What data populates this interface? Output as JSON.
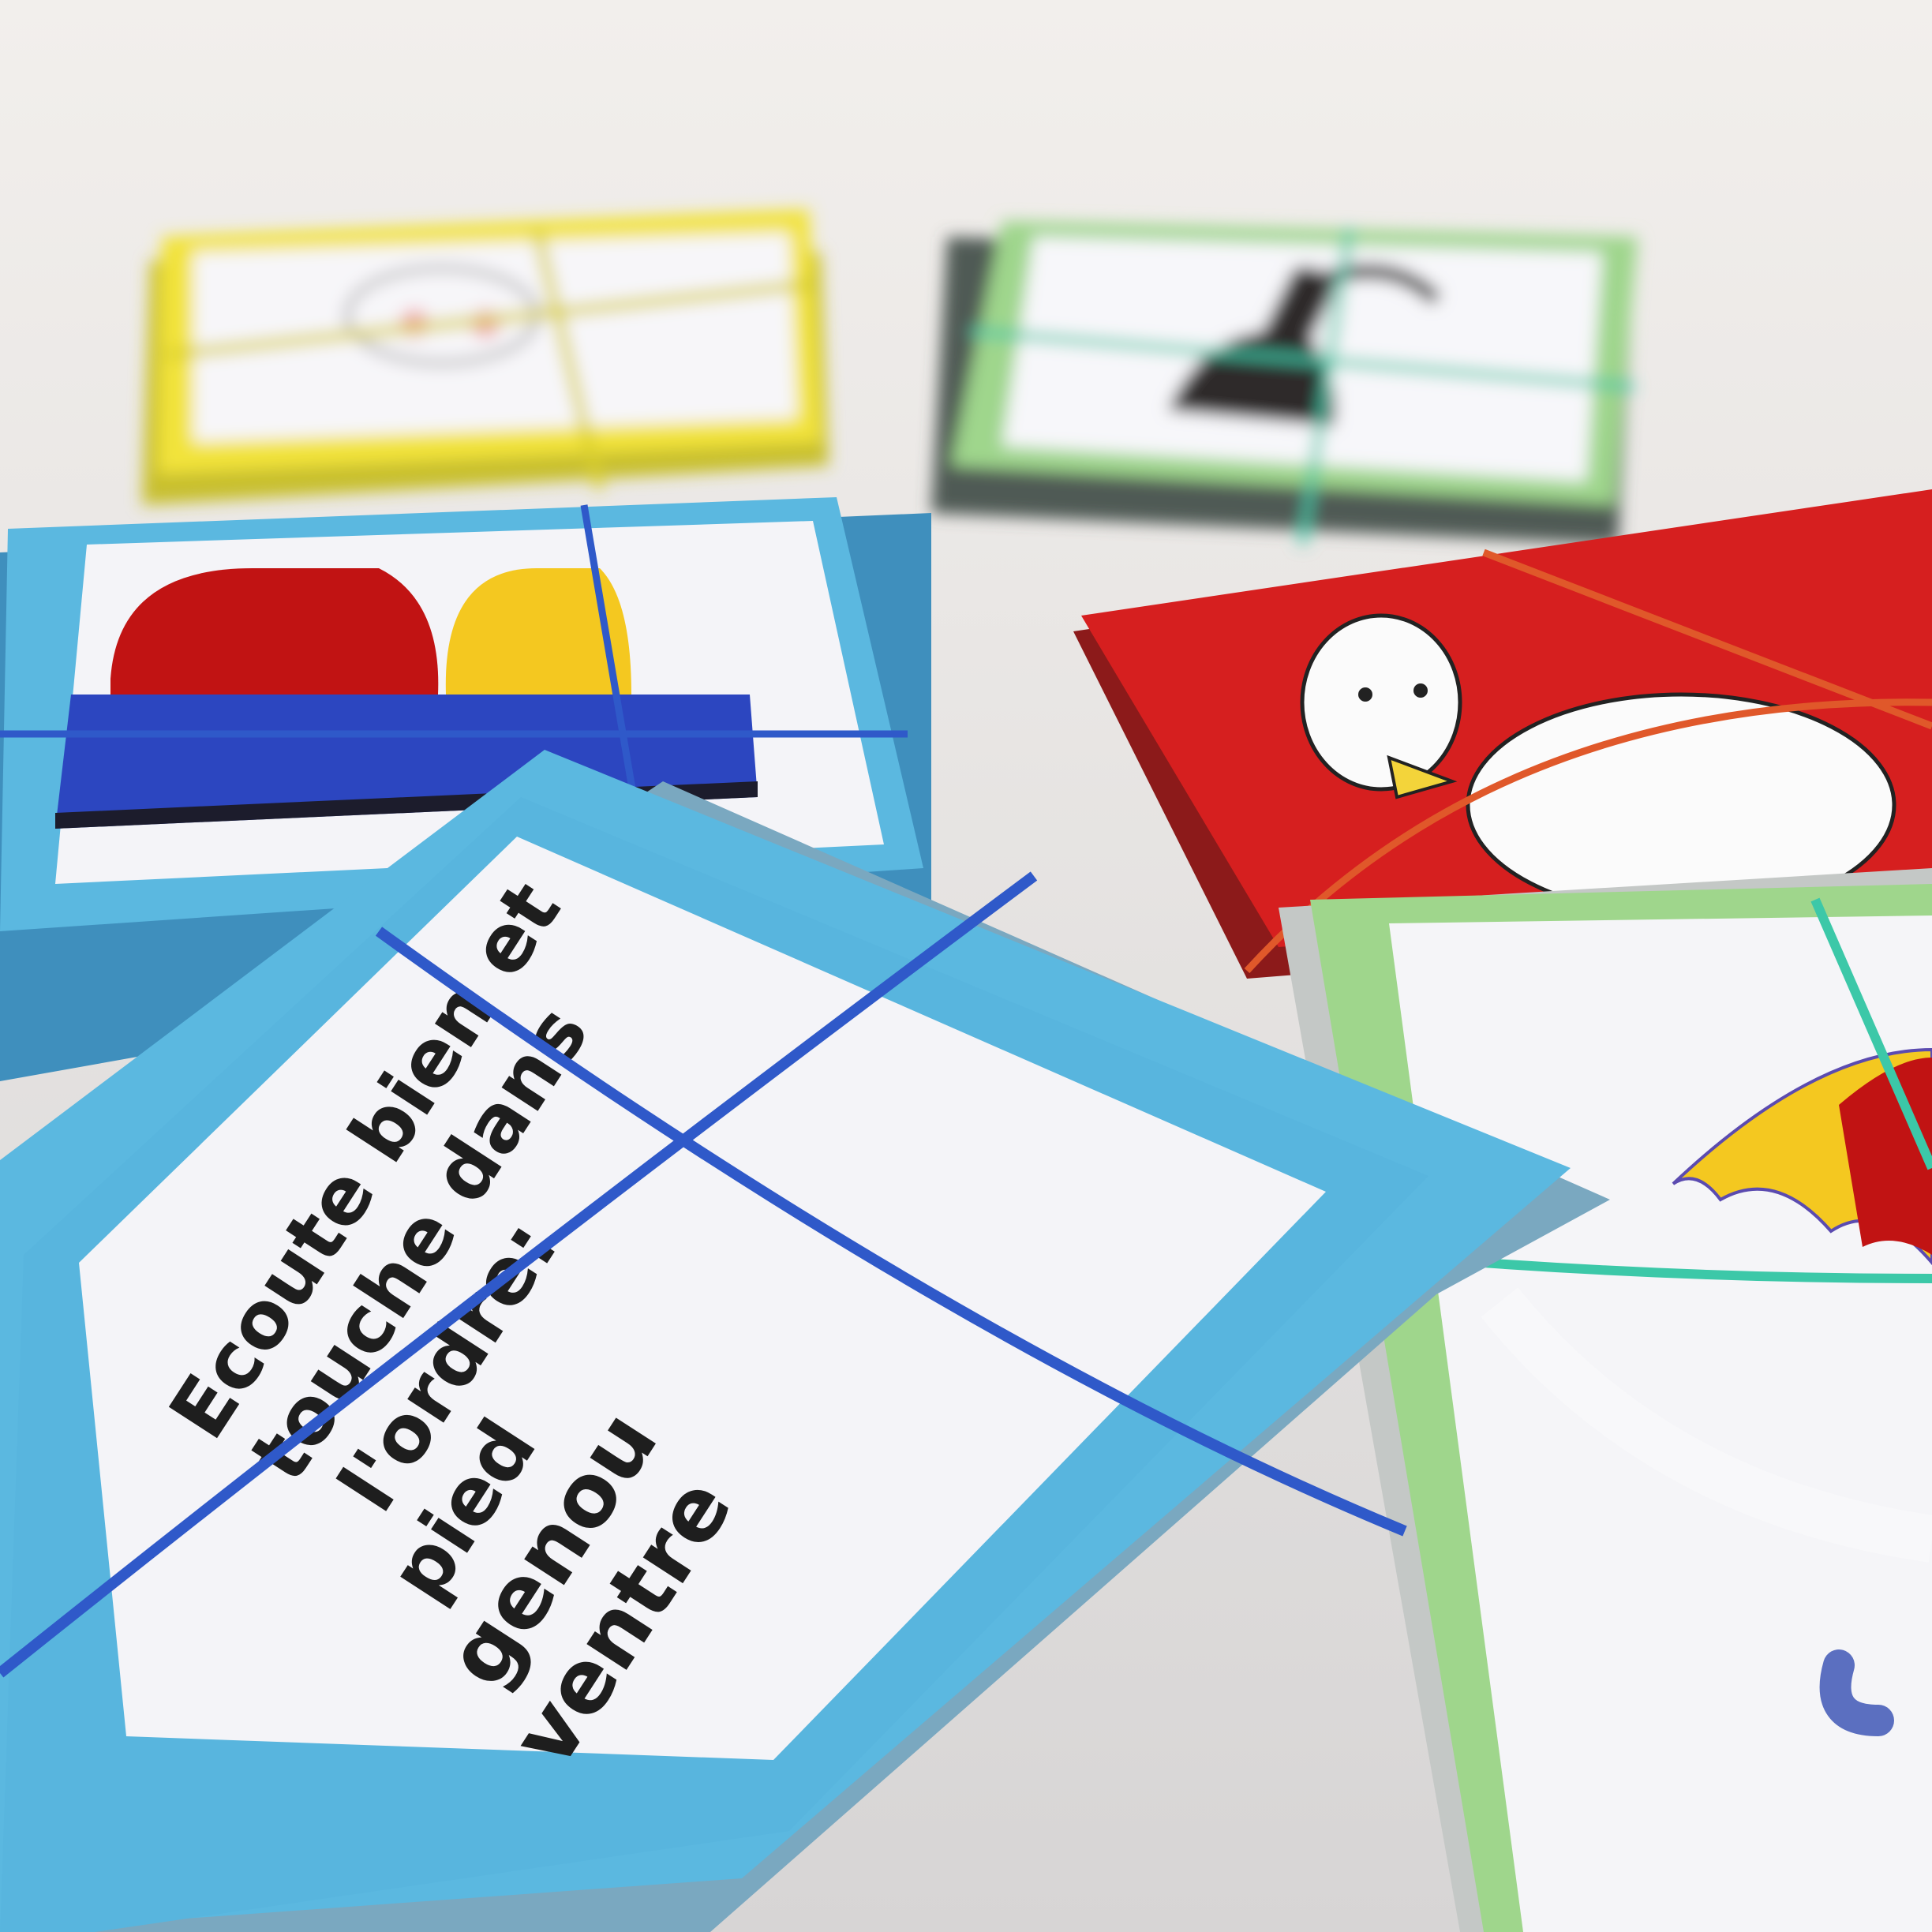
{
  "colors": {
    "table": "#e9e6e2",
    "yellow_deck": "#f2e33a",
    "green_deck": "#9fd68c",
    "blue_deck": "#5bb8e0",
    "red_deck": "#d61f1f",
    "blue_band": "#2f59c9",
    "green_band": "#3cc8a8",
    "orange_band": "#e0582a"
  },
  "instruction_card": {
    "lines": [
      "Ecoute bien et",
      "touche dans",
      "l'ordre:",
      "pied",
      "genou",
      "ventre"
    ]
  },
  "decks": [
    {
      "color": "yellow",
      "picture": "face-drawing-icon"
    },
    {
      "color": "green",
      "picture": "dog-silhouette-icon"
    },
    {
      "color": "blue",
      "picture": "building-blocks-icon"
    },
    {
      "color": "red",
      "picture": "bird-icon"
    },
    {
      "color": "green",
      "picture": "umbrella-icon"
    },
    {
      "color": "blue",
      "picture": "instruction-text"
    }
  ]
}
